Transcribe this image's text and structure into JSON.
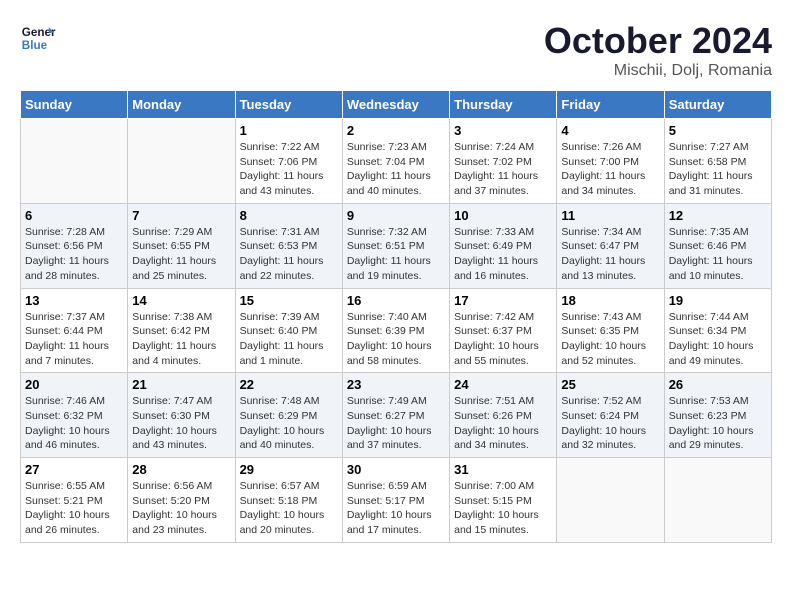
{
  "header": {
    "logo_line1": "General",
    "logo_line2": "Blue",
    "title": "October 2024",
    "subtitle": "Mischii, Dolj, Romania"
  },
  "calendar": {
    "days_of_week": [
      "Sunday",
      "Monday",
      "Tuesday",
      "Wednesday",
      "Thursday",
      "Friday",
      "Saturday"
    ],
    "weeks": [
      [
        {
          "day": "",
          "info": ""
        },
        {
          "day": "",
          "info": ""
        },
        {
          "day": "1",
          "info": "Sunrise: 7:22 AM\nSunset: 7:06 PM\nDaylight: 11 hours and 43 minutes."
        },
        {
          "day": "2",
          "info": "Sunrise: 7:23 AM\nSunset: 7:04 PM\nDaylight: 11 hours and 40 minutes."
        },
        {
          "day": "3",
          "info": "Sunrise: 7:24 AM\nSunset: 7:02 PM\nDaylight: 11 hours and 37 minutes."
        },
        {
          "day": "4",
          "info": "Sunrise: 7:26 AM\nSunset: 7:00 PM\nDaylight: 11 hours and 34 minutes."
        },
        {
          "day": "5",
          "info": "Sunrise: 7:27 AM\nSunset: 6:58 PM\nDaylight: 11 hours and 31 minutes."
        }
      ],
      [
        {
          "day": "6",
          "info": "Sunrise: 7:28 AM\nSunset: 6:56 PM\nDaylight: 11 hours and 28 minutes."
        },
        {
          "day": "7",
          "info": "Sunrise: 7:29 AM\nSunset: 6:55 PM\nDaylight: 11 hours and 25 minutes."
        },
        {
          "day": "8",
          "info": "Sunrise: 7:31 AM\nSunset: 6:53 PM\nDaylight: 11 hours and 22 minutes."
        },
        {
          "day": "9",
          "info": "Sunrise: 7:32 AM\nSunset: 6:51 PM\nDaylight: 11 hours and 19 minutes."
        },
        {
          "day": "10",
          "info": "Sunrise: 7:33 AM\nSunset: 6:49 PM\nDaylight: 11 hours and 16 minutes."
        },
        {
          "day": "11",
          "info": "Sunrise: 7:34 AM\nSunset: 6:47 PM\nDaylight: 11 hours and 13 minutes."
        },
        {
          "day": "12",
          "info": "Sunrise: 7:35 AM\nSunset: 6:46 PM\nDaylight: 11 hours and 10 minutes."
        }
      ],
      [
        {
          "day": "13",
          "info": "Sunrise: 7:37 AM\nSunset: 6:44 PM\nDaylight: 11 hours and 7 minutes."
        },
        {
          "day": "14",
          "info": "Sunrise: 7:38 AM\nSunset: 6:42 PM\nDaylight: 11 hours and 4 minutes."
        },
        {
          "day": "15",
          "info": "Sunrise: 7:39 AM\nSunset: 6:40 PM\nDaylight: 11 hours and 1 minute."
        },
        {
          "day": "16",
          "info": "Sunrise: 7:40 AM\nSunset: 6:39 PM\nDaylight: 10 hours and 58 minutes."
        },
        {
          "day": "17",
          "info": "Sunrise: 7:42 AM\nSunset: 6:37 PM\nDaylight: 10 hours and 55 minutes."
        },
        {
          "day": "18",
          "info": "Sunrise: 7:43 AM\nSunset: 6:35 PM\nDaylight: 10 hours and 52 minutes."
        },
        {
          "day": "19",
          "info": "Sunrise: 7:44 AM\nSunset: 6:34 PM\nDaylight: 10 hours and 49 minutes."
        }
      ],
      [
        {
          "day": "20",
          "info": "Sunrise: 7:46 AM\nSunset: 6:32 PM\nDaylight: 10 hours and 46 minutes."
        },
        {
          "day": "21",
          "info": "Sunrise: 7:47 AM\nSunset: 6:30 PM\nDaylight: 10 hours and 43 minutes."
        },
        {
          "day": "22",
          "info": "Sunrise: 7:48 AM\nSunset: 6:29 PM\nDaylight: 10 hours and 40 minutes."
        },
        {
          "day": "23",
          "info": "Sunrise: 7:49 AM\nSunset: 6:27 PM\nDaylight: 10 hours and 37 minutes."
        },
        {
          "day": "24",
          "info": "Sunrise: 7:51 AM\nSunset: 6:26 PM\nDaylight: 10 hours and 34 minutes."
        },
        {
          "day": "25",
          "info": "Sunrise: 7:52 AM\nSunset: 6:24 PM\nDaylight: 10 hours and 32 minutes."
        },
        {
          "day": "26",
          "info": "Sunrise: 7:53 AM\nSunset: 6:23 PM\nDaylight: 10 hours and 29 minutes."
        }
      ],
      [
        {
          "day": "27",
          "info": "Sunrise: 6:55 AM\nSunset: 5:21 PM\nDaylight: 10 hours and 26 minutes."
        },
        {
          "day": "28",
          "info": "Sunrise: 6:56 AM\nSunset: 5:20 PM\nDaylight: 10 hours and 23 minutes."
        },
        {
          "day": "29",
          "info": "Sunrise: 6:57 AM\nSunset: 5:18 PM\nDaylight: 10 hours and 20 minutes."
        },
        {
          "day": "30",
          "info": "Sunrise: 6:59 AM\nSunset: 5:17 PM\nDaylight: 10 hours and 17 minutes."
        },
        {
          "day": "31",
          "info": "Sunrise: 7:00 AM\nSunset: 5:15 PM\nDaylight: 10 hours and 15 minutes."
        },
        {
          "day": "",
          "info": ""
        },
        {
          "day": "",
          "info": ""
        }
      ]
    ]
  }
}
